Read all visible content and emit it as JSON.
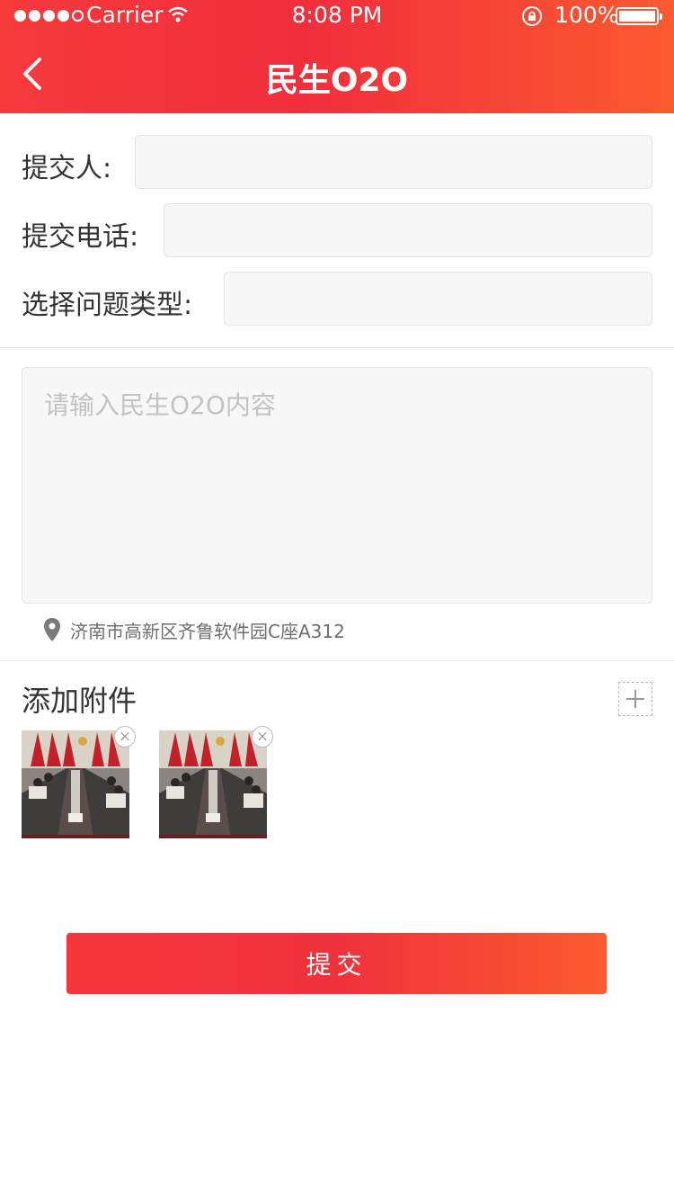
{
  "status_bar": {
    "carrier": "Carrier",
    "time": "8:08 PM",
    "battery": "100%"
  },
  "nav": {
    "title": "民生O2O"
  },
  "form": {
    "submitter_label": "提交人:",
    "submitter_value": "",
    "phone_label": "提交电话:",
    "phone_value": "",
    "type_label": "选择问题类型:",
    "type_value": "",
    "content_placeholder": "请输入民生O2O内容",
    "location": "济南市高新区齐鲁软件园C座A312"
  },
  "attachments": {
    "title": "添加附件",
    "count": 2
  },
  "submit_label": "提交",
  "colors": {
    "header_start": "#f53a3c",
    "header_end": "#fb5a30",
    "field_bg": "#f7f7f8"
  }
}
